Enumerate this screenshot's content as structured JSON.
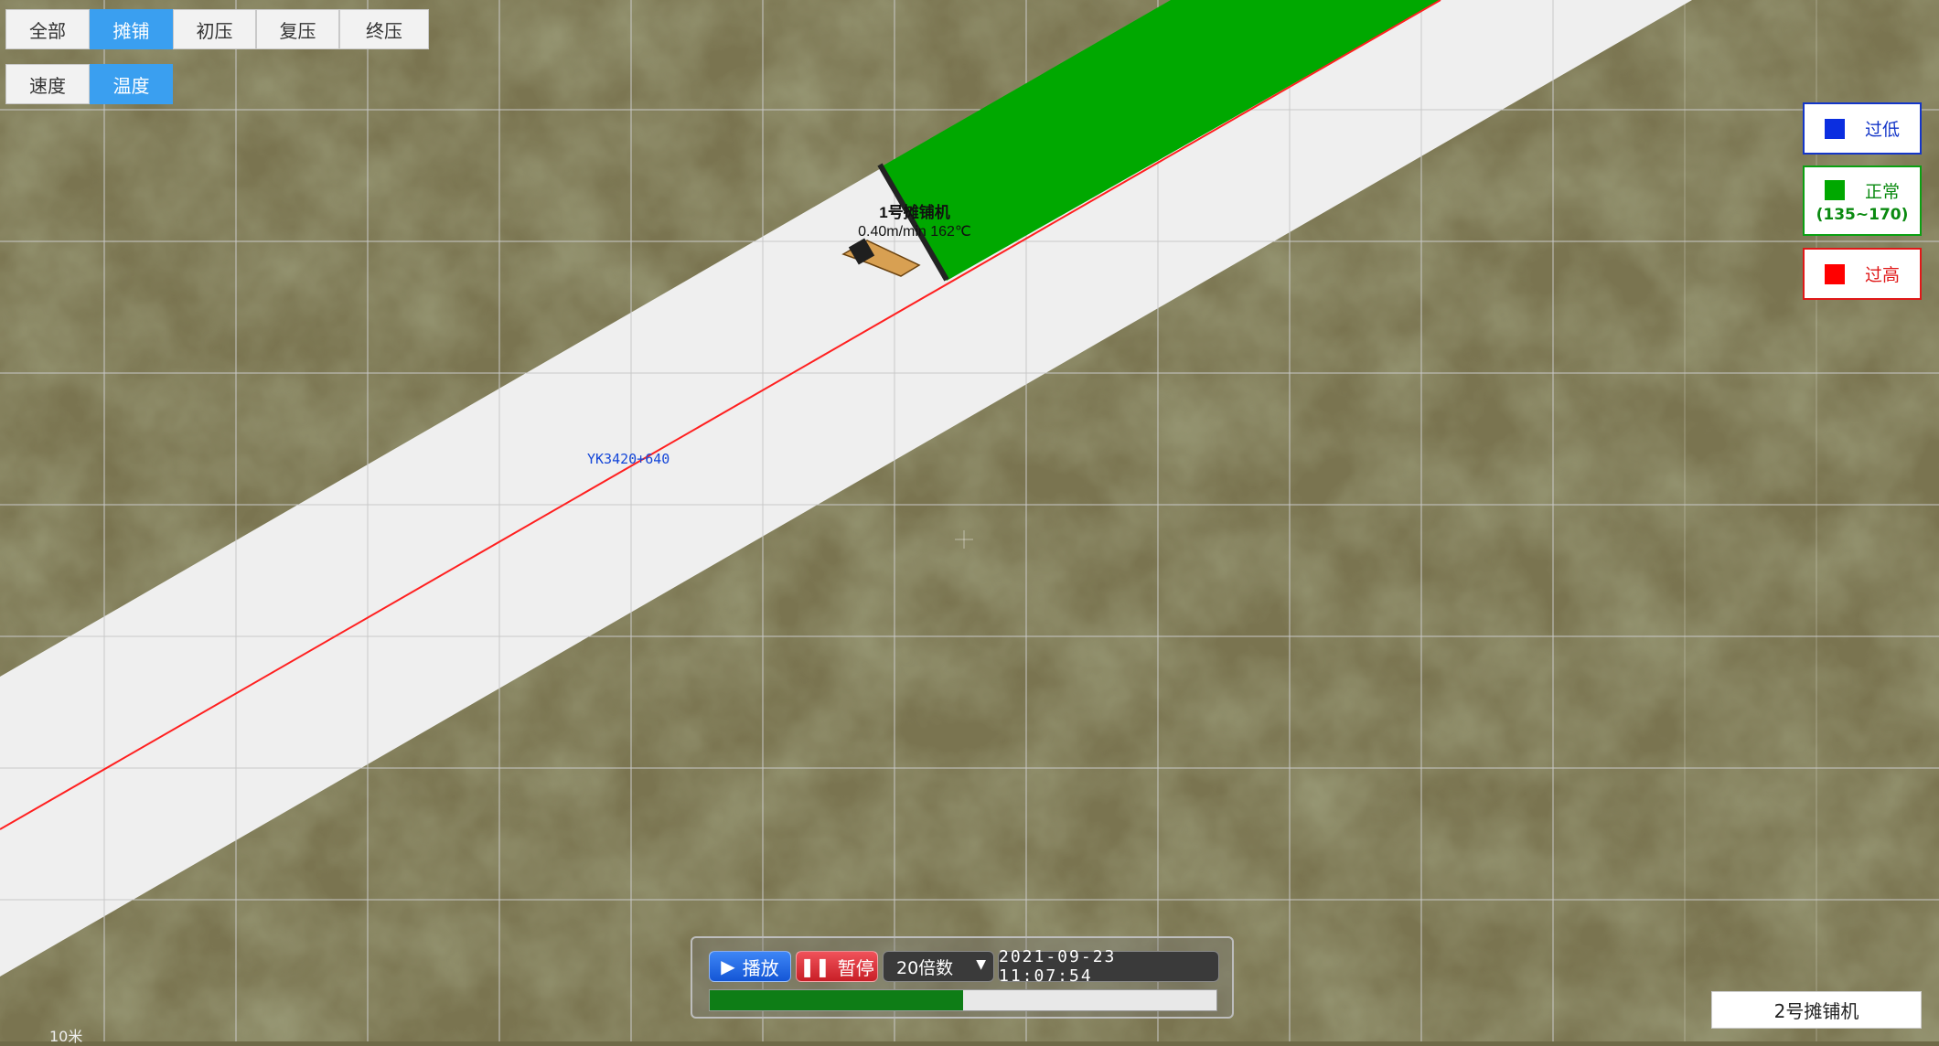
{
  "layer_tabs": {
    "items": [
      {
        "label": "全部",
        "active": false
      },
      {
        "label": "摊铺",
        "active": true
      },
      {
        "label": "初压",
        "active": false
      },
      {
        "label": "复压",
        "active": false
      },
      {
        "label": "终压",
        "active": false
      }
    ]
  },
  "mode_tabs": {
    "items": [
      {
        "label": "速度",
        "active": false
      },
      {
        "label": "温度",
        "active": true
      }
    ]
  },
  "legend": {
    "low": {
      "label": "过低",
      "color": "#0b2ee0"
    },
    "normal": {
      "label": "正常",
      "range": "(135~170)",
      "color": "#00a800"
    },
    "high": {
      "label": "过高",
      "color": "#ff0000"
    }
  },
  "map": {
    "station_label": "YK3420+640",
    "paver": {
      "name": "1号摊铺机",
      "status": "0.40m/min 162℃"
    },
    "road_color": "#efefef",
    "paved_color": "#00a800",
    "centerline_color": "#ff2020",
    "scale_label": "10米"
  },
  "player": {
    "play_label": "播放",
    "pause_label": "暂停",
    "speed": "20倍数",
    "timestamp": "2021-09-23 11:07:54",
    "progress": 0.5
  },
  "machine_tag": "2号摊铺机"
}
